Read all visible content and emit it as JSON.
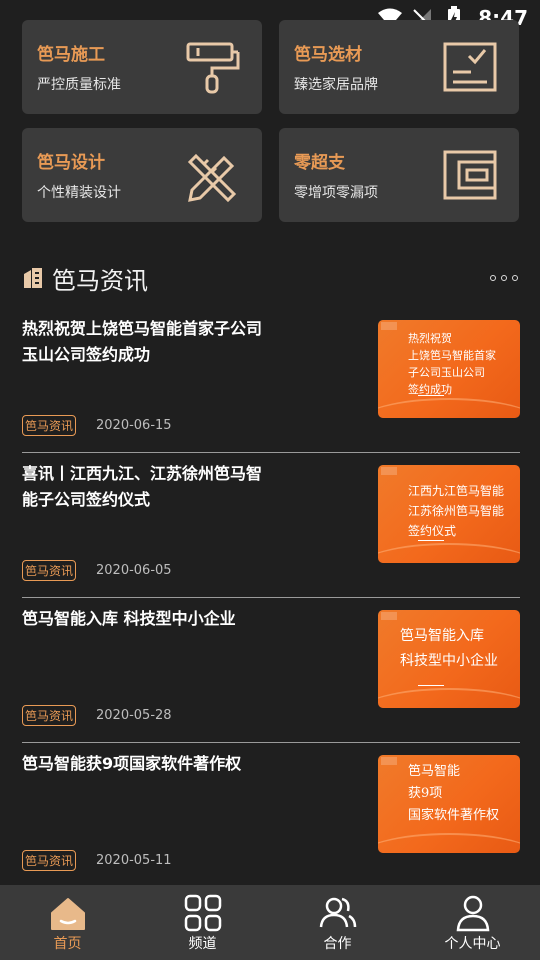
{
  "status_bar": {
    "time": "8:47"
  },
  "cards": [
    {
      "title": "笆马施工",
      "subtitle": "严控质量标准",
      "icon": "paint-roller-icon"
    },
    {
      "title": "笆马选材",
      "subtitle": "臻选家居品牌",
      "icon": "checklist-icon"
    },
    {
      "title": "笆马设计",
      "subtitle": "个性精装设计",
      "icon": "pencil-ruler-icon"
    },
    {
      "title": "零超支",
      "subtitle": "零增项零漏项",
      "icon": "wallet-icon"
    }
  ],
  "section": {
    "title": "笆马资讯"
  },
  "news": [
    {
      "title": "热烈祝贺上饶笆马智能首家子公司玉山公司签约成功",
      "tag": "笆马资讯",
      "date": "2020-06-15",
      "thumb_lines": [
        "热烈祝贺",
        "上饶笆马智能首家",
        "子公司玉山公司",
        "签约成功"
      ]
    },
    {
      "title": "喜讯丨江西九江、江苏徐州笆马智能子公司签约仪式",
      "tag": "笆马资讯",
      "date": "2020-06-05",
      "thumb_lines": [
        "江西九江笆马智能",
        "江苏徐州笆马智能",
        "签约仪式"
      ]
    },
    {
      "title": "笆马智能入库 科技型中小企业",
      "tag": "笆马资讯",
      "date": "2020-05-28",
      "thumb_lines": [
        "笆马智能入库",
        "科技型中小企业"
      ]
    },
    {
      "title": "笆马智能获9项国家软件著作权",
      "tag": "笆马资讯",
      "date": "2020-05-11",
      "thumb_lines": [
        "笆马智能",
        "获9项",
        "国家软件著作权"
      ]
    }
  ],
  "tabs": [
    {
      "label": "首页",
      "icon": "home-icon",
      "active": true
    },
    {
      "label": "频道",
      "icon": "grid-icon",
      "active": false
    },
    {
      "label": "合作",
      "icon": "users-icon",
      "active": false
    },
    {
      "label": "个人中心",
      "icon": "user-icon",
      "active": false
    }
  ],
  "colors": {
    "accent": "#e89a55",
    "card_bg": "#3b3b3b",
    "page_bg": "#1f1f1f",
    "thumb": "#f3691c"
  }
}
